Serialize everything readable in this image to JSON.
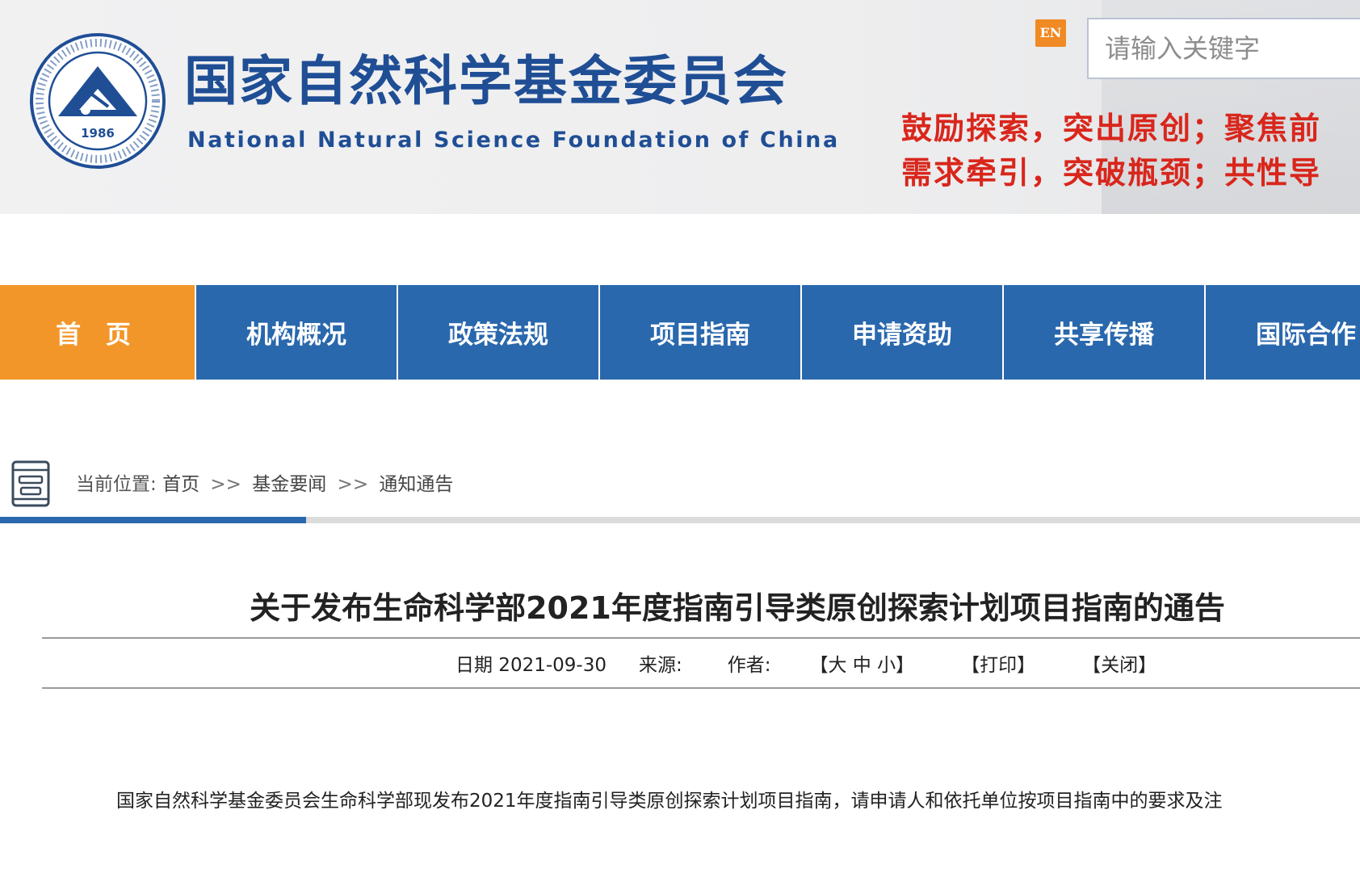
{
  "header": {
    "emblem_year": "1986",
    "org_name_cn": "国家自然科学基金委员会",
    "org_name_en": "National Natural Science Foundation of China",
    "lang_button": "EN",
    "search_placeholder": "请输入关键字",
    "slogan_line1": "鼓励探索，突出原创；聚焦前",
    "slogan_line2": "需求牵引，突破瓶颈；共性导",
    "colors": {
      "brand_blue": "#1f4e95",
      "slogan_red": "#d9261c",
      "lang_orange": "#f08a24"
    }
  },
  "nav": {
    "items": [
      {
        "label": "首 页",
        "active": true
      },
      {
        "label": "机构概况",
        "active": false
      },
      {
        "label": "政策法规",
        "active": false
      },
      {
        "label": "项目指南",
        "active": false
      },
      {
        "label": "申请资助",
        "active": false
      },
      {
        "label": "共享传播",
        "active": false
      },
      {
        "label": "国际合作",
        "active": false
      }
    ],
    "colors": {
      "active": "#f39629",
      "default": "#2a68ad"
    }
  },
  "breadcrumb": {
    "icon": "document-box-icon",
    "prefix": "当前位置:",
    "items": [
      "首页",
      "基金要闻",
      "通知通告"
    ],
    "separator": ">>"
  },
  "article": {
    "title": "关于发布生命科学部2021年度指南引导类原创探索计划项目指南的通告",
    "meta": {
      "date": "日期 2021-09-30",
      "source": "来源:",
      "author": "作者:",
      "font_size": "【大 中 小】",
      "print": "【打印】",
      "close": "【关闭】"
    },
    "body": "国家自然科学基金委员会生命科学部现发布2021年度指南引导类原创探索计划项目指南，请申请人和依托单位按项目指南中的要求及注"
  }
}
